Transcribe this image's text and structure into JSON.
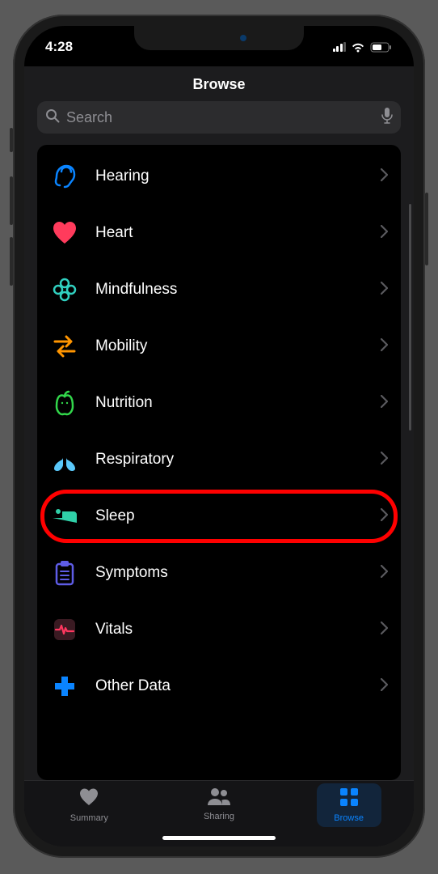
{
  "status": {
    "time": "4:28"
  },
  "header": {
    "title": "Browse"
  },
  "search": {
    "placeholder": "Search"
  },
  "categories": [
    {
      "id": "hearing",
      "label": "Hearing",
      "icon": "ear-icon",
      "color": "#0a84ff",
      "highlighted": false
    },
    {
      "id": "heart",
      "label": "Heart",
      "icon": "heart-icon",
      "color": "#ff3b5c",
      "highlighted": false
    },
    {
      "id": "mindfulness",
      "label": "Mindfulness",
      "icon": "mindfulness-icon",
      "color": "#30d0c0",
      "highlighted": false
    },
    {
      "id": "mobility",
      "label": "Mobility",
      "icon": "mobility-icon",
      "color": "#ff9500",
      "highlighted": false
    },
    {
      "id": "nutrition",
      "label": "Nutrition",
      "icon": "nutrition-icon",
      "color": "#32d74b",
      "highlighted": false
    },
    {
      "id": "respiratory",
      "label": "Respiratory",
      "icon": "respiratory-icon",
      "color": "#5ac8fa",
      "highlighted": false
    },
    {
      "id": "sleep",
      "label": "Sleep",
      "icon": "sleep-icon",
      "color": "#30d0a8",
      "highlighted": true
    },
    {
      "id": "symptoms",
      "label": "Symptoms",
      "icon": "symptoms-icon",
      "color": "#5e5ce6",
      "highlighted": false
    },
    {
      "id": "vitals",
      "label": "Vitals",
      "icon": "vitals-icon",
      "color": "#ff375f",
      "highlighted": false
    },
    {
      "id": "other-data",
      "label": "Other Data",
      "icon": "other-data-icon",
      "color": "#0a84ff",
      "highlighted": false
    }
  ],
  "tabs": [
    {
      "id": "summary",
      "label": "Summary",
      "icon": "heart-icon",
      "active": false
    },
    {
      "id": "sharing",
      "label": "Sharing",
      "icon": "people-icon",
      "active": false
    },
    {
      "id": "browse",
      "label": "Browse",
      "icon": "grid-icon",
      "active": true
    }
  ]
}
